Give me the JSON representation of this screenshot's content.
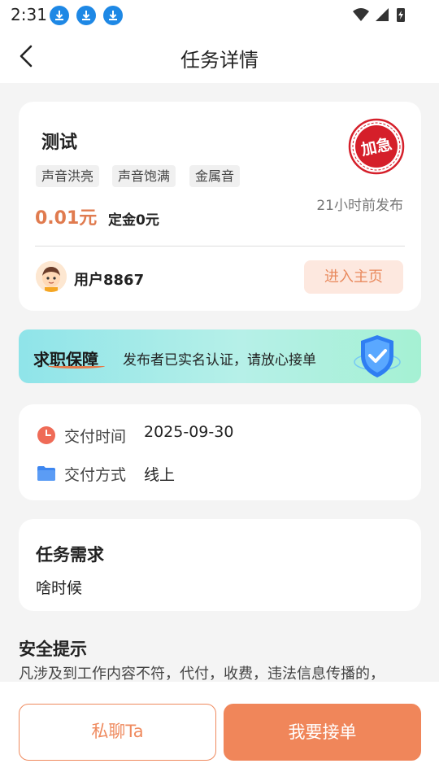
{
  "status_bar": {
    "time": "2:31"
  },
  "nav": {
    "title": "任务详情",
    "back_icon": "chevron-left-icon"
  },
  "task": {
    "title": "测试",
    "tags": [
      "声音洪亮",
      "声音饱满",
      "金属音"
    ],
    "price": "0.01元",
    "deposit": "定金0元",
    "posted": "21小时前发布",
    "stamp_text": "加急",
    "user": {
      "name": "用户8867"
    },
    "home_button": "进入主页"
  },
  "banner": {
    "title": "求职保障",
    "text": "发布者已实名认证，请放心接单"
  },
  "delivery": {
    "time_label": "交付时间",
    "time_value": "2025-09-30",
    "method_label": "交付方式",
    "method_value": "线上"
  },
  "requirements": {
    "title": "任务需求",
    "text": "啥时候"
  },
  "safety": {
    "title": "安全提示",
    "text": "凡涉及到工作内容不符，代付，收费，违法信息传播的，"
  },
  "actions": {
    "chat": "私聊Ta",
    "accept": "我要接单"
  },
  "colors": {
    "accent": "#f0865a",
    "price": "#e07b4f",
    "stamp": "#d51f2a"
  }
}
